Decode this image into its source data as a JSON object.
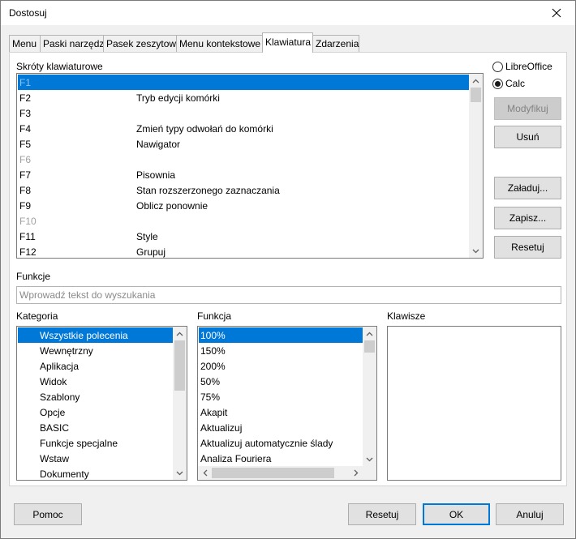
{
  "window": {
    "title": "Dostosuj",
    "close_icon": "close-icon"
  },
  "tabs": [
    {
      "label": "Menu"
    },
    {
      "label": "Paski narzędzi"
    },
    {
      "label": "Pasek zeszytowy"
    },
    {
      "label": "Menu kontekstowe"
    },
    {
      "label": "Klawiatura",
      "active": true
    },
    {
      "label": "Zdarzenia"
    }
  ],
  "shortcuts": {
    "label": "Skróty klawiaturowe",
    "rows": [
      {
        "key": "F1",
        "command": "",
        "selected": true,
        "dim": true
      },
      {
        "key": "F2",
        "command": "Tryb edycji komórki"
      },
      {
        "key": "F3",
        "command": ""
      },
      {
        "key": "F4",
        "command": "Zmień typy odwołań do komórki"
      },
      {
        "key": "F5",
        "command": "Nawigator"
      },
      {
        "key": "F6",
        "command": "",
        "dim": true
      },
      {
        "key": "F7",
        "command": "Pisownia"
      },
      {
        "key": "F8",
        "command": "Stan rozszerzonego zaznaczania"
      },
      {
        "key": "F9",
        "command": "Oblicz ponownie"
      },
      {
        "key": "F10",
        "command": "",
        "dim": true
      },
      {
        "key": "F11",
        "command": "Style"
      },
      {
        "key": "F12",
        "command": "Grupuj"
      }
    ]
  },
  "scope": {
    "option1": "LibreOffice",
    "option2": "Calc",
    "selected": "Calc"
  },
  "side_buttons": {
    "modify": "Modyfikuj",
    "delete": "Usuń",
    "load": "Załaduj...",
    "save": "Zapisz...",
    "reset": "Resetuj"
  },
  "functions_search": {
    "label": "Funkcje",
    "placeholder": "Wprowadź tekst do wyszukania"
  },
  "category": {
    "label": "Kategoria",
    "items": [
      "Wszystkie polecenia",
      "Wewnętrzny",
      "Aplikacja",
      "Widok",
      "Szablony",
      "Opcje",
      "BASIC",
      "Funkcje specjalne",
      "Wstaw",
      "Dokumenty"
    ],
    "selected_index": 0
  },
  "function": {
    "label": "Funkcja",
    "items": [
      "100%",
      "150%",
      "200%",
      "50%",
      "75%",
      "Akapit",
      "Aktualizuj",
      "Aktualizuj automatycznie ślady",
      "Analiza Fouriera"
    ],
    "selected_index": 0
  },
  "keys": {
    "label": "Klawisze"
  },
  "footer": {
    "help": "Pomoc",
    "reset": "Resetuj",
    "ok": "OK",
    "cancel": "Anuluj"
  },
  "colors": {
    "selection": "#0078d7",
    "default_button_border": "#0078d7"
  }
}
